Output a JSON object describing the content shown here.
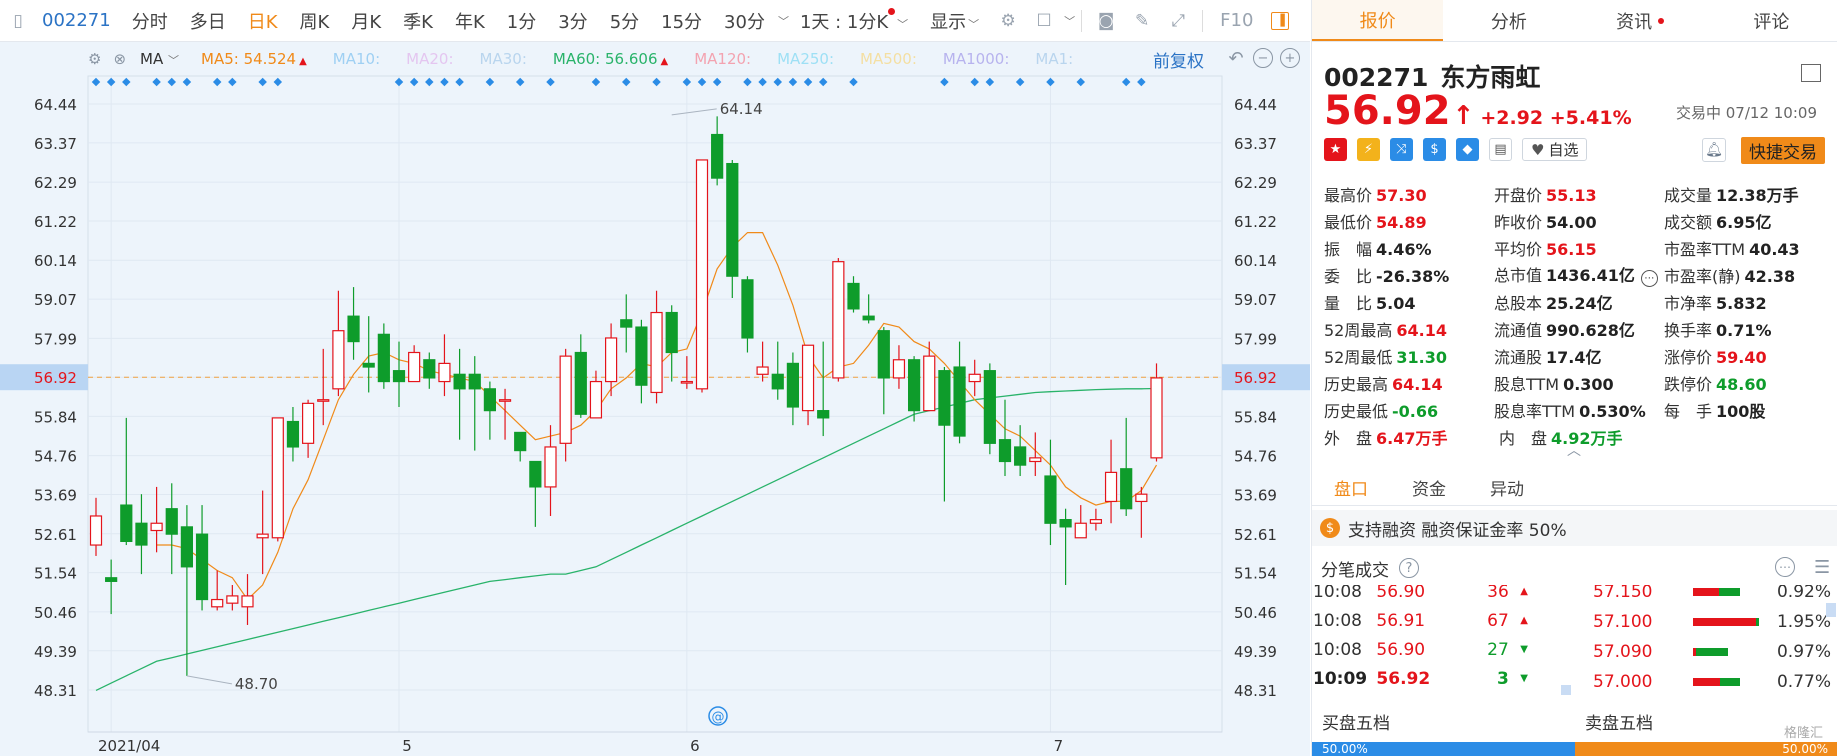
{
  "toolbar": {
    "code": "002271",
    "periods": [
      "分时",
      "多日",
      "日K",
      "周K",
      "月K",
      "季K",
      "年K",
      "1分",
      "3分",
      "5分",
      "15分",
      "30分"
    ],
    "active_period": "日K",
    "minute_select": "1天 : 1分K",
    "display": "显示",
    "f10": "F10"
  },
  "ma_legend": {
    "label": "MA",
    "items": [
      {
        "name": "MA5",
        "value": "54.524",
        "color": "#f08a19",
        "up": true
      },
      {
        "name": "MA10",
        "value": "",
        "color": "#9fd0f3"
      },
      {
        "name": "MA20",
        "value": "",
        "color": "#e4c6f0"
      },
      {
        "name": "MA30",
        "value": "",
        "color": "#b9d5ee"
      },
      {
        "name": "MA60",
        "value": "56.606",
        "color": "#29b36a",
        "up": true
      },
      {
        "name": "MA120",
        "value": "",
        "color": "#f3a3b0"
      },
      {
        "name": "MA250",
        "value": "",
        "color": "#9ee0f5"
      },
      {
        "name": "MA500",
        "value": "",
        "color": "#f4dfa2"
      },
      {
        "name": "MA1000",
        "value": "",
        "color": "#b7b3ee"
      },
      {
        "name": "MA1",
        "value": "",
        "color": "#b9d5ee"
      }
    ],
    "adjust": "前复权"
  },
  "chart_data": {
    "type": "candlestick",
    "y_ticks": [
      "64.44",
      "63.37",
      "62.29",
      "61.22",
      "60.14",
      "59.07",
      "57.99",
      "56.92",
      "55.84",
      "54.76",
      "53.69",
      "52.61",
      "51.54",
      "50.46",
      "49.39",
      "48.31"
    ],
    "ylim": [
      47.9,
      65.0
    ],
    "current_price": 56.92,
    "x_labels": [
      {
        "label": "2021/04",
        "index": 1
      },
      {
        "label": "5",
        "index": 20
      },
      {
        "label": "6",
        "index": 39
      },
      {
        "label": "7",
        "index": 63
      }
    ],
    "annotations": [
      {
        "label": "64.14",
        "index": 38,
        "price": 64.14
      },
      {
        "label": "48.70",
        "index": 6,
        "price": 48.7
      }
    ],
    "candles": [
      [
        52.3,
        53.1,
        52.0,
        53.6
      ],
      [
        51.4,
        51.3,
        50.4,
        51.9
      ],
      [
        53.4,
        52.4,
        52.3,
        55.8
      ],
      [
        52.9,
        52.3,
        51.5,
        53.7
      ],
      [
        52.7,
        52.9,
        52.1,
        53.9
      ],
      [
        53.3,
        52.6,
        51.5,
        54.0
      ],
      [
        52.8,
        51.7,
        48.7,
        53.4
      ],
      [
        52.6,
        50.8,
        50.5,
        53.4
      ],
      [
        50.6,
        50.8,
        50.5,
        51.6
      ],
      [
        50.7,
        50.9,
        50.5,
        51.2
      ],
      [
        50.6,
        50.9,
        50.1,
        51.5
      ],
      [
        52.5,
        52.6,
        51.5,
        53.8
      ],
      [
        52.5,
        55.8,
        52.4,
        55.8
      ],
      [
        55.7,
        55.0,
        54.6,
        56.1
      ],
      [
        55.1,
        56.2,
        54.7,
        56.3
      ],
      [
        56.3,
        56.3,
        55.6,
        57.7
      ],
      [
        56.6,
        58.2,
        56.4,
        59.3
      ],
      [
        58.6,
        57.9,
        57.4,
        59.4
      ],
      [
        57.3,
        57.2,
        56.5,
        58.6
      ],
      [
        58.1,
        56.8,
        56.6,
        58.4
      ],
      [
        57.1,
        56.8,
        56.1,
        57.9
      ],
      [
        56.8,
        57.6,
        56.8,
        57.8
      ],
      [
        57.4,
        56.9,
        56.6,
        57.6
      ],
      [
        56.8,
        57.3,
        56.4,
        58.1
      ],
      [
        57.0,
        56.6,
        55.2,
        57.7
      ],
      [
        57.0,
        56.6,
        54.9,
        57.5
      ],
      [
        56.6,
        56.0,
        55.2,
        56.8
      ],
      [
        56.3,
        56.3,
        55.2,
        56.6
      ],
      [
        55.4,
        54.9,
        54.6,
        55.4
      ],
      [
        54.6,
        53.9,
        52.8,
        54.6
      ],
      [
        53.9,
        55.0,
        53.1,
        55.6
      ],
      [
        55.1,
        57.5,
        54.6,
        57.7
      ],
      [
        57.6,
        55.9,
        55.8,
        58.1
      ],
      [
        55.8,
        56.8,
        55.8,
        57.1
      ],
      [
        56.8,
        58.0,
        56.4,
        58.4
      ],
      [
        58.5,
        58.3,
        57.6,
        59.2
      ],
      [
        58.3,
        56.7,
        56.2,
        58.5
      ],
      [
        56.5,
        58.7,
        56.2,
        59.3
      ],
      [
        58.7,
        57.6,
        56.8,
        58.9
      ],
      [
        56.8,
        56.8,
        56.6,
        57.5
      ],
      [
        56.6,
        62.9,
        56.5,
        62.9
      ],
      [
        63.6,
        62.4,
        62.2,
        64.1
      ],
      [
        62.8,
        59.7,
        59.1,
        62.9
      ],
      [
        59.6,
        58.0,
        57.6,
        59.7
      ],
      [
        57.0,
        57.2,
        56.8,
        57.9
      ],
      [
        57.0,
        56.6,
        56.3,
        57.9
      ],
      [
        57.3,
        56.1,
        55.6,
        57.6
      ],
      [
        56.0,
        57.8,
        55.6,
        57.8
      ],
      [
        56.0,
        55.8,
        55.3,
        57.9
      ],
      [
        56.9,
        60.1,
        56.8,
        60.2
      ],
      [
        59.5,
        58.8,
        58.7,
        59.7
      ],
      [
        58.6,
        58.5,
        58.4,
        59.2
      ],
      [
        58.2,
        56.9,
        55.9,
        58.3
      ],
      [
        56.9,
        57.4,
        56.6,
        57.8
      ],
      [
        57.4,
        56.0,
        55.7,
        57.5
      ],
      [
        56.0,
        57.5,
        56.6,
        57.9
      ],
      [
        57.1,
        55.6,
        53.5,
        57.2
      ],
      [
        57.2,
        55.3,
        55.1,
        57.9
      ],
      [
        56.8,
        57.0,
        56.4,
        57.4
      ],
      [
        57.1,
        55.1,
        54.8,
        57.3
      ],
      [
        55.2,
        54.6,
        54.2,
        56.3
      ],
      [
        55.0,
        54.5,
        54.2,
        55.6
      ],
      [
        54.6,
        54.7,
        54.2,
        55.4
      ],
      [
        54.2,
        52.9,
        52.3,
        55.2
      ],
      [
        53.0,
        52.8,
        51.2,
        53.3
      ],
      [
        52.5,
        52.9,
        52.5,
        53.4
      ],
      [
        52.9,
        53.0,
        52.7,
        53.3
      ],
      [
        53.5,
        54.3,
        52.9,
        55.2
      ],
      [
        54.4,
        53.3,
        53.1,
        55.8
      ],
      [
        53.5,
        53.7,
        52.5,
        53.9
      ],
      [
        54.7,
        56.9,
        54.6,
        57.3
      ]
    ],
    "ma5": [
      null,
      null,
      null,
      null,
      52.3,
      52.3,
      52.2,
      51.9,
      51.6,
      51.4,
      50.8,
      51.2,
      52.1,
      53.3,
      54.1,
      55.2,
      56.3,
      57.0,
      57.5,
      57.6,
      57.4,
      57.3,
      57.1,
      57.0,
      56.9,
      56.8,
      56.4,
      56.0,
      55.6,
      55.2,
      55.3,
      55.4,
      55.6,
      56.0,
      56.6,
      56.9,
      57.3,
      57.2,
      57.6,
      57.7,
      58.7,
      59.9,
      60.5,
      60.9,
      60.9,
      60.0,
      58.9,
      57.5,
      56.9,
      57.2,
      57.3,
      57.8,
      58.4,
      58.3,
      57.9,
      57.7,
      57.3,
      56.8,
      56.3,
      55.9,
      55.5,
      55.3,
      54.9,
      54.5,
      53.9,
      53.6,
      53.4,
      53.5,
      53.5,
      53.8,
      54.5
    ],
    "ma60": [
      48.3,
      48.5,
      48.7,
      48.9,
      49.1,
      49.2,
      49.3,
      49.4,
      49.5,
      49.6,
      49.7,
      49.8,
      49.9,
      50.0,
      50.1,
      50.2,
      50.3,
      50.4,
      50.5,
      50.6,
      50.7,
      50.8,
      50.9,
      51.0,
      51.1,
      51.2,
      51.3,
      51.35,
      51.4,
      51.45,
      51.5,
      51.5,
      51.6,
      51.7,
      51.9,
      52.1,
      52.3,
      52.5,
      52.7,
      52.9,
      53.1,
      53.3,
      53.5,
      53.7,
      53.9,
      54.1,
      54.3,
      54.5,
      54.7,
      54.9,
      55.1,
      55.3,
      55.5,
      55.7,
      55.9,
      56.0,
      56.1,
      56.2,
      56.3,
      56.35,
      56.4,
      56.45,
      56.5,
      56.52,
      56.54,
      56.56,
      56.58,
      56.59,
      56.6,
      56.6,
      56.61
    ],
    "markers": [
      0,
      1,
      2,
      4,
      5,
      6,
      8,
      9,
      11,
      12,
      20,
      21,
      22,
      23,
      24,
      26,
      28,
      30,
      33,
      35,
      37,
      39,
      40,
      41,
      43,
      44,
      45,
      46,
      47,
      48,
      50,
      56,
      58,
      59,
      61,
      63,
      65,
      68,
      69
    ]
  },
  "panel": {
    "tabs": [
      {
        "label": "报价",
        "active": true
      },
      {
        "label": "分析"
      },
      {
        "label": "资讯",
        "dot": true
      },
      {
        "label": "评论"
      }
    ],
    "code": "002271",
    "name": "东方雨虹",
    "price": "56.92",
    "change": "+2.92",
    "change_pct": "+5.41%",
    "status": "交易中 07/12 10:09",
    "zixuan": "自选",
    "fast_trade": "快捷交易",
    "stats": [
      [
        {
          "k": "最高价",
          "v": "57.30",
          "c": "red"
        },
        {
          "k": "开盘价",
          "v": "55.13",
          "c": "red"
        },
        {
          "k": "成交量",
          "v": "12.38万手",
          "c": "dark"
        }
      ],
      [
        {
          "k": "最低价",
          "v": "54.89",
          "c": "red"
        },
        {
          "k": "昨收价",
          "v": "54.00",
          "c": "dark"
        },
        {
          "k": "成交额",
          "v": "6.95亿",
          "c": "dark"
        }
      ],
      [
        {
          "k": "振　幅",
          "v": "4.46%",
          "c": "dark"
        },
        {
          "k": "平均价",
          "v": "56.15",
          "c": "red"
        },
        {
          "k": "市盈率TTM",
          "v": "40.43",
          "c": "dark"
        }
      ],
      [
        {
          "k": "委　比",
          "v": "-26.38%",
          "c": "dark"
        },
        {
          "k": "总市值",
          "v": "1436.41亿",
          "c": "dark"
        },
        {
          "k": "市盈率(静)",
          "v": "42.38",
          "c": "dark"
        }
      ],
      [
        {
          "k": "量　比",
          "v": "5.04",
          "c": "dark"
        },
        {
          "k": "总股本",
          "v": "25.24亿",
          "c": "dark"
        },
        {
          "k": "市净率",
          "v": "5.832",
          "c": "dark"
        }
      ],
      [
        {
          "k": "52周最高",
          "v": "64.14",
          "c": "red"
        },
        {
          "k": "流通值",
          "v": "990.628亿",
          "c": "dark"
        },
        {
          "k": "换手率",
          "v": "0.71%",
          "c": "dark"
        }
      ],
      [
        {
          "k": "52周最低",
          "v": "31.30",
          "c": "green"
        },
        {
          "k": "流通股",
          "v": "17.4亿",
          "c": "dark"
        },
        {
          "k": "涨停价",
          "v": "59.40",
          "c": "red"
        }
      ],
      [
        {
          "k": "历史最高",
          "v": "64.14",
          "c": "red"
        },
        {
          "k": "股息TTM",
          "v": "0.300",
          "c": "dark"
        },
        {
          "k": "跌停价",
          "v": "48.60",
          "c": "green"
        }
      ],
      [
        {
          "k": "历史最低",
          "v": "-0.66",
          "c": "green"
        },
        {
          "k": "股息率TTM",
          "v": "0.530%",
          "c": "dark"
        },
        {
          "k": "每　手",
          "v": "100股",
          "c": "dark"
        }
      ],
      [
        {
          "k": "外　盘",
          "v": "6.47万手",
          "c": "red"
        },
        {
          "k": "内　盘",
          "v": "4.92万手",
          "c": "green"
        }
      ]
    ],
    "sub_tabs": [
      {
        "label": "盘口",
        "active": true
      },
      {
        "label": "资金"
      },
      {
        "label": "异动"
      }
    ],
    "rongzi": "支持融资 融资保证金率 50%",
    "fenbi_title": "分笔成交",
    "ticks": [
      {
        "t": "10:08",
        "p": "56.90",
        "v": "36",
        "d": "up"
      },
      {
        "t": "10:08",
        "p": "56.91",
        "v": "67",
        "d": "up"
      },
      {
        "t": "10:08",
        "p": "56.90",
        "v": "27",
        "d": "down"
      },
      {
        "t": "10:09",
        "p": "56.92",
        "v": "3",
        "d": "down"
      }
    ],
    "book": [
      {
        "p": "57.150",
        "pct": "0.92%",
        "red": 0.38,
        "green": 0.62
      },
      {
        "p": "57.100",
        "pct": "1.95%",
        "red": 0.92,
        "green": 0.08
      },
      {
        "p": "57.090",
        "pct": "0.97%",
        "red": 0.05,
        "green": 0.95
      },
      {
        "p": "57.000",
        "pct": "0.77%",
        "red": 0.4,
        "green": 0.6
      }
    ],
    "wudang_buy": "买盘五档",
    "wudang_sell": "卖盘五档",
    "buy_pct": "50.00%",
    "sell_pct": "50.00%",
    "watermark": "格隆汇"
  }
}
